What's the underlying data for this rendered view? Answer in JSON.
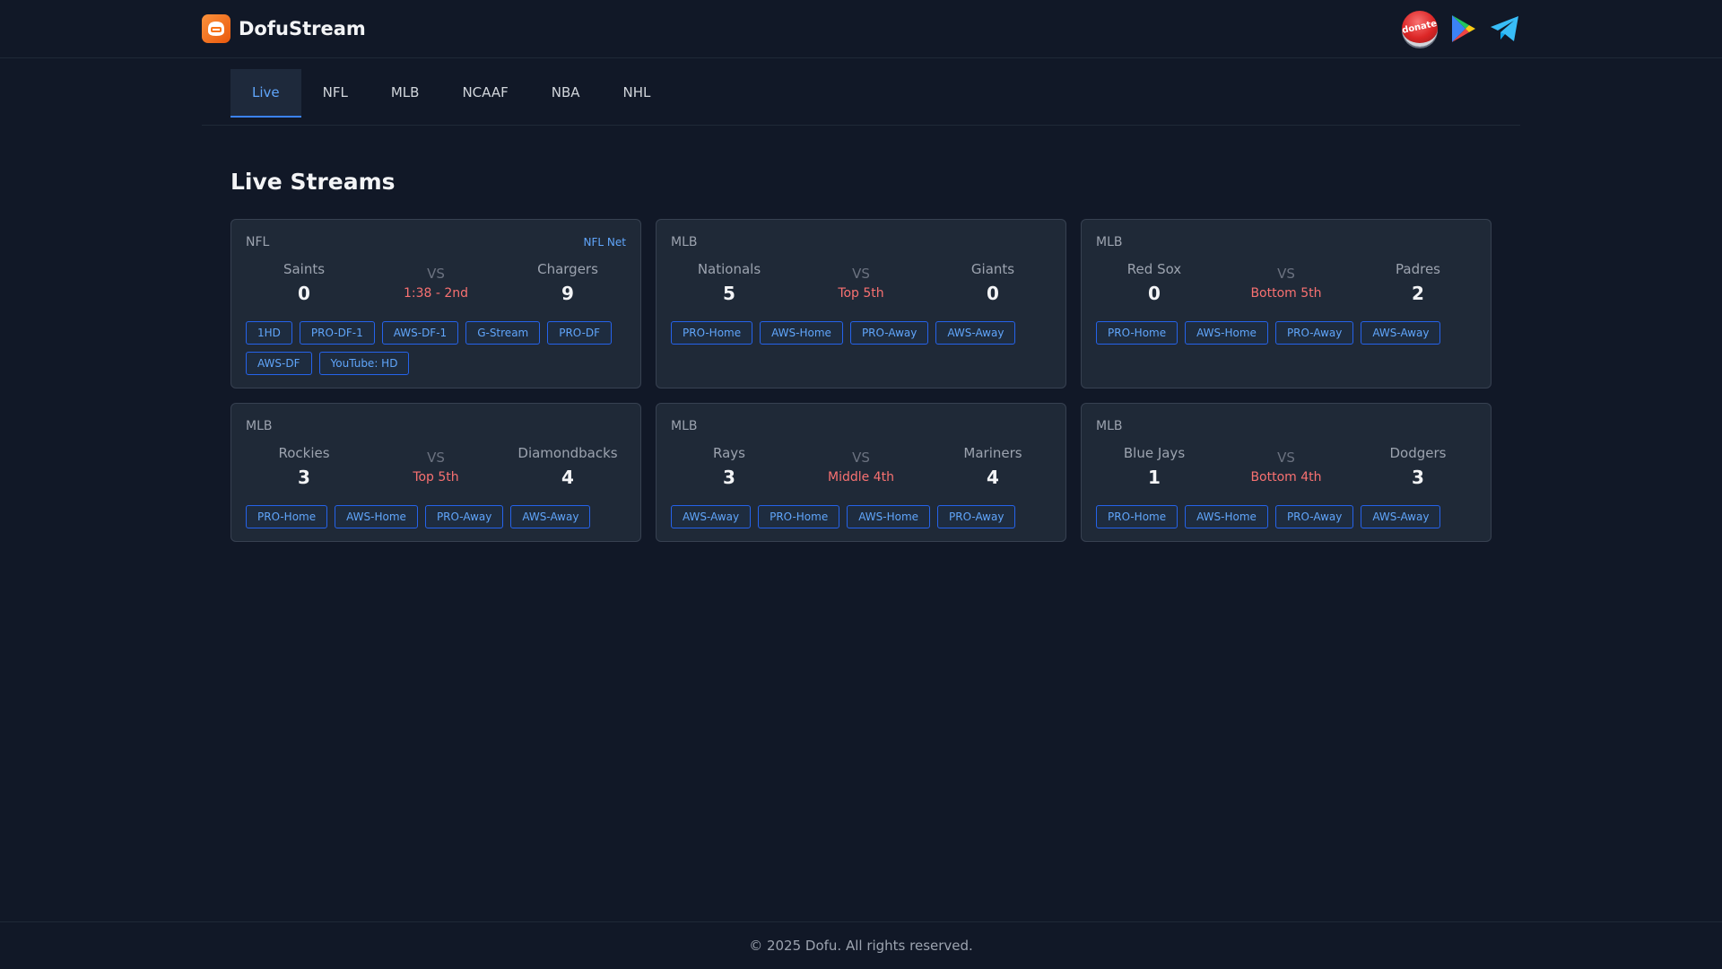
{
  "brand": {
    "name": "DofuStream"
  },
  "header_icons": {
    "donate_label": "donate"
  },
  "tabs": [
    "Live",
    "NFL",
    "MLB",
    "NCAAF",
    "NBA",
    "NHL"
  ],
  "page_title": "Live Streams",
  "games": [
    {
      "league": "NFL",
      "network": "NFL Net",
      "home": "Saints",
      "home_score": "0",
      "vs": "VS",
      "status": "1:38 - 2nd",
      "away": "Chargers",
      "away_score": "9",
      "streams": [
        "1HD",
        "PRO-DF-1",
        "AWS-DF-1",
        "G-Stream",
        "PRO-DF",
        "AWS-DF",
        "YouTube: HD"
      ]
    },
    {
      "league": "MLB",
      "network": "",
      "home": "Nationals",
      "home_score": "5",
      "vs": "VS",
      "status": "Top 5th",
      "away": "Giants",
      "away_score": "0",
      "streams": [
        "PRO-Home",
        "AWS-Home",
        "PRO-Away",
        "AWS-Away"
      ]
    },
    {
      "league": "MLB",
      "network": "",
      "home": "Red Sox",
      "home_score": "0",
      "vs": "VS",
      "status": "Bottom 5th",
      "away": "Padres",
      "away_score": "2",
      "streams": [
        "PRO-Home",
        "AWS-Home",
        "PRO-Away",
        "AWS-Away"
      ]
    },
    {
      "league": "MLB",
      "network": "",
      "home": "Rockies",
      "home_score": "3",
      "vs": "VS",
      "status": "Top 5th",
      "away": "Diamondbacks",
      "away_score": "4",
      "streams": [
        "PRO-Home",
        "AWS-Home",
        "PRO-Away",
        "AWS-Away"
      ]
    },
    {
      "league": "MLB",
      "network": "",
      "home": "Rays",
      "home_score": "3",
      "vs": "VS",
      "status": "Middle 4th",
      "away": "Mariners",
      "away_score": "4",
      "streams": [
        "AWS-Away",
        "PRO-Home",
        "AWS-Home",
        "PRO-Away"
      ]
    },
    {
      "league": "MLB",
      "network": "",
      "home": "Blue Jays",
      "home_score": "1",
      "vs": "VS",
      "status": "Bottom 4th",
      "away": "Dodgers",
      "away_score": "3",
      "streams": [
        "PRO-Home",
        "AWS-Home",
        "PRO-Away",
        "AWS-Away"
      ]
    }
  ],
  "footer": {
    "text": "© 2025 Dofu. All rights reserved."
  },
  "colors": {
    "background": "#111827",
    "card": "#1f2937",
    "accent": "#60a5fa",
    "status": "#f87171",
    "brand": "#f97316"
  }
}
